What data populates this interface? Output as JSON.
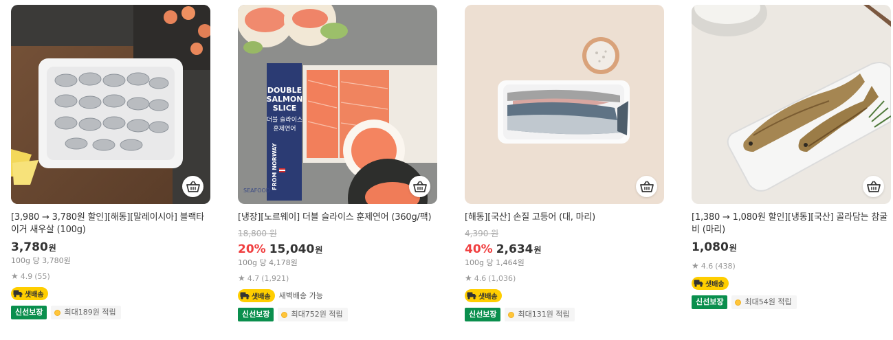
{
  "currency_unit": "원",
  "products": [
    {
      "title": "[3,980 → 3,780원 할인][해동][말레이시아] 블랙타이거 새우살 (100g)",
      "original_price": "",
      "discount": "",
      "price": "3,780",
      "unit_price": "100g 당 3,780원",
      "rating": "4.9",
      "reviews": "(55)",
      "shipping_badge": "샛배송",
      "dawn_delivery": "",
      "fresh_tag": "신선보장",
      "points": "최대189원 적립"
    },
    {
      "title": "[냉장][노르웨이] 더블 슬라이스 훈제연어 (360g/팩)",
      "original_price": "18,800 원",
      "discount": "20%",
      "price": "15,040",
      "unit_price": "100g 당 4,178원",
      "rating": "4.7",
      "reviews": "(1,921)",
      "shipping_badge": "샛배송",
      "dawn_delivery": "새벽배송 가능",
      "fresh_tag": "신선보장",
      "points": "최대752원 적립",
      "image_text": {
        "double": "DOUBLE",
        "salmon": "SALMON",
        "slice": "SLICE",
        "kor1": "더블 슬라이스",
        "kor2": "훈제연어",
        "seafood": "SEAFOOD",
        "from_norway": "FROM NORWAY"
      }
    },
    {
      "title": "[해동][국산] 손질 고등어 (대, 마리)",
      "original_price": "4,390 원",
      "discount": "40%",
      "price": "2,634",
      "unit_price": "100g 당 1,464원",
      "rating": "4.6",
      "reviews": "(1,036)",
      "shipping_badge": "샛배송",
      "dawn_delivery": "",
      "fresh_tag": "신선보장",
      "points": "최대131원 적립"
    },
    {
      "title": "[1,380 → 1,080원 할인][냉동][국산] 골라담는 참굴비 (마리)",
      "original_price": "",
      "discount": "",
      "price": "1,080",
      "unit_price": "",
      "rating": "4.6",
      "reviews": "(438)",
      "shipping_badge": "샛배송",
      "dawn_delivery": "",
      "fresh_tag": "신선보장",
      "points": "최대54원 적립"
    }
  ],
  "colors": {
    "discount": "#f03f40",
    "fresh_tag": "#0a8f4d",
    "shipping_badge": "#ffce00"
  },
  "icons": [
    "cart-icon",
    "star-icon",
    "truck-icon",
    "point-coin-icon"
  ]
}
